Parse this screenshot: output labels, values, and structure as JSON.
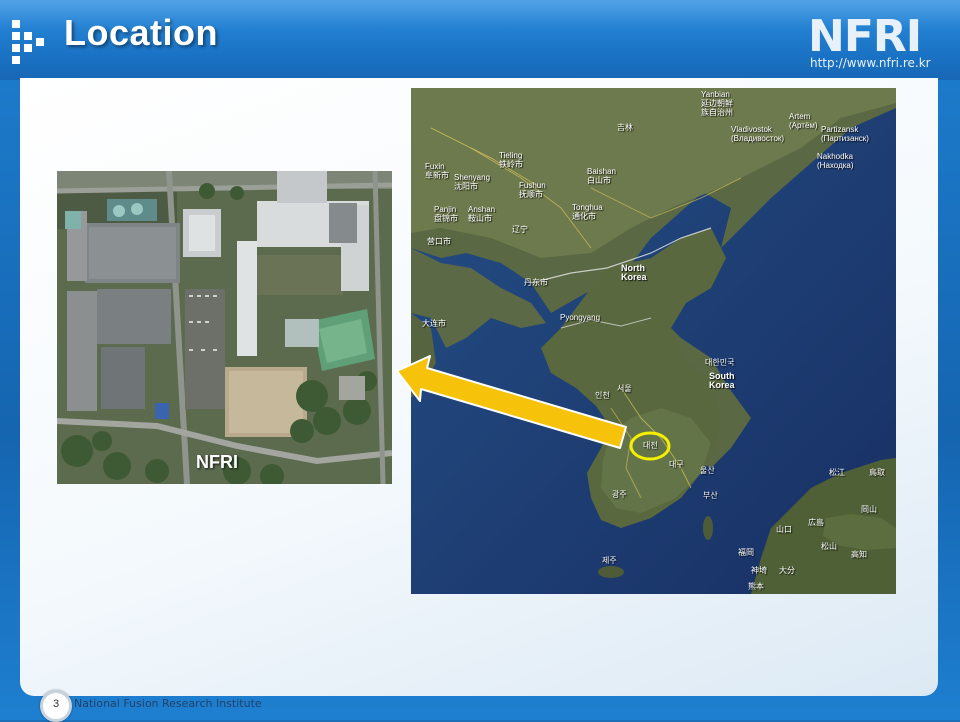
{
  "slide": {
    "title": "Location",
    "page_number": "3",
    "footer_org": "National Fusion Research Institute"
  },
  "brand": {
    "name": "NFRI",
    "url": "http://www.nfri.re.kr"
  },
  "aerial": {
    "label": "NFRI"
  },
  "map": {
    "labels": [
      {
        "name": "map-label-yanbian",
        "text": "Yanbian\n延边朝鲜\n族自治州"
      },
      {
        "name": "map-label-vladivostok",
        "text": "Vladivostok\n(Владивосток)"
      },
      {
        "name": "map-label-artem",
        "text": "Artem\n(Артём)"
      },
      {
        "name": "map-label-partizansk",
        "text": "Partizansk\n(Партизанск)"
      },
      {
        "name": "map-label-nakhodka",
        "text": "Nakhodka\n(Находка)"
      },
      {
        "name": "map-label-jilin",
        "text": "吉林"
      },
      {
        "name": "map-label-fuxin",
        "text": "Fuxin\n阜新市"
      },
      {
        "name": "map-label-tieling",
        "text": "Tieling\n铁岭市"
      },
      {
        "name": "map-label-shenyang",
        "text": "Shenyang\n沈阳市"
      },
      {
        "name": "map-label-fushun",
        "text": "Fushun\n抚顺市"
      },
      {
        "name": "map-label-baishan",
        "text": "Baishan\n白山市"
      },
      {
        "name": "map-label-panjin",
        "text": "Panjin\n盘锦市"
      },
      {
        "name": "map-label-anshan",
        "text": "Anshan\n鞍山市"
      },
      {
        "name": "map-label-tonghua",
        "text": "Tonghua\n通化市"
      },
      {
        "name": "map-label-liaoning",
        "text": "辽宁"
      },
      {
        "name": "map-label-yingkou",
        "text": "营口市"
      },
      {
        "name": "map-label-dandong",
        "text": "丹东市"
      },
      {
        "name": "map-label-north-korea",
        "text": "North\nKorea"
      },
      {
        "name": "map-label-pyongyang",
        "text": "Pyongyang"
      },
      {
        "name": "map-label-dalian",
        "text": "大连市"
      },
      {
        "name": "map-label-daehanminguk",
        "text": "대한민국"
      },
      {
        "name": "map-label-south-korea",
        "text": "South\nKorea"
      },
      {
        "name": "map-label-seoul",
        "text": "서울"
      },
      {
        "name": "map-label-incheon",
        "text": "인천"
      },
      {
        "name": "map-label-daejeon",
        "text": "대전"
      },
      {
        "name": "map-label-daegu",
        "text": "대구"
      },
      {
        "name": "map-label-ulsan",
        "text": "울산"
      },
      {
        "name": "map-label-busan",
        "text": "부산"
      },
      {
        "name": "map-label-gwangju",
        "text": "광주"
      },
      {
        "name": "map-label-jeju",
        "text": "제주"
      },
      {
        "name": "map-label-matsue",
        "text": "松江"
      },
      {
        "name": "map-label-tottori",
        "text": "鳥取"
      },
      {
        "name": "map-label-hiroshima",
        "text": "広島"
      },
      {
        "name": "map-label-okayama",
        "text": "岡山"
      },
      {
        "name": "map-label-yamaguchi",
        "text": "山口"
      },
      {
        "name": "map-label-matsuyama",
        "text": "松山"
      },
      {
        "name": "map-label-takamatsu",
        "text": "高知"
      },
      {
        "name": "map-label-fukuoka",
        "text": "福岡"
      },
      {
        "name": "map-label-kumamoto",
        "text": "神埼"
      },
      {
        "name": "map-label-oita",
        "text": "大分"
      },
      {
        "name": "map-label-kagoshima",
        "text": "熊本"
      }
    ]
  },
  "colors": {
    "header": "#1a72c4",
    "arrow": "#f7c20a",
    "highlight_ring": "#f4f000"
  }
}
